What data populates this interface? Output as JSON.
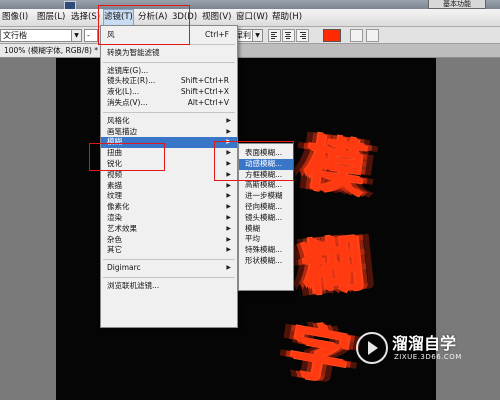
{
  "titlebar": {
    "zoom_fragment": "100%",
    "essentials_label": "基本功能"
  },
  "menubar": {
    "items": [
      "图像(I)",
      "图层(L)",
      "选择(S)",
      "滤镜(T)",
      "分析(A)",
      "3D(D)",
      "视图(V)",
      "窗口(W)",
      "帮助(H)"
    ],
    "active_index": 3
  },
  "options": {
    "font_family": "文行楷",
    "font_style": "-",
    "antialias": "犀利",
    "text_color": "#ff2a00"
  },
  "document": {
    "tab_label": "100% (模糊字体, RGB/8) *"
  },
  "canvas": {
    "chars": [
      "模",
      "糊",
      "字"
    ],
    "text_color": "#ff3a10"
  },
  "filter_menu": {
    "items": [
      {
        "label": "风",
        "shortcut": "Ctrl+F"
      },
      {
        "sep": true
      },
      {
        "label": "转换为智能滤镜"
      },
      {
        "sep": true
      },
      {
        "label": "滤镜库(G)..."
      },
      {
        "label": "镜头校正(R)...",
        "shortcut": "Shift+Ctrl+R"
      },
      {
        "label": "液化(L)...",
        "shortcut": "Shift+Ctrl+X"
      },
      {
        "label": "消失点(V)...",
        "shortcut": "Alt+Ctrl+V"
      },
      {
        "sep": true
      },
      {
        "label": "风格化",
        "submenu": true
      },
      {
        "label": "画笔描边",
        "submenu": true
      },
      {
        "label": "模糊",
        "submenu": true,
        "highlighted": true
      },
      {
        "label": "扭曲",
        "submenu": true
      },
      {
        "label": "锐化",
        "submenu": true
      },
      {
        "label": "视频",
        "submenu": true
      },
      {
        "label": "素描",
        "submenu": true
      },
      {
        "label": "纹理",
        "submenu": true
      },
      {
        "label": "像素化",
        "submenu": true
      },
      {
        "label": "渲染",
        "submenu": true
      },
      {
        "label": "艺术效果",
        "submenu": true
      },
      {
        "label": "杂色",
        "submenu": true
      },
      {
        "label": "其它",
        "submenu": true
      },
      {
        "sep": true
      },
      {
        "label": "Digimarc",
        "submenu": true
      },
      {
        "sep": true
      },
      {
        "label": "浏览联机滤镜..."
      }
    ]
  },
  "blur_submenu": {
    "items": [
      {
        "label": "表面模糊..."
      },
      {
        "label": "动感模糊...",
        "highlighted": true
      },
      {
        "label": "方框模糊..."
      },
      {
        "label": "高斯模糊..."
      },
      {
        "label": "进一步模糊"
      },
      {
        "label": "径向模糊..."
      },
      {
        "label": "镜头模糊..."
      },
      {
        "label": "模糊"
      },
      {
        "label": "平均"
      },
      {
        "label": "特殊模糊..."
      },
      {
        "label": "形状模糊..."
      }
    ]
  },
  "watermark": {
    "name": "溜溜自学",
    "url": "ZIXUE.3D66.COM"
  },
  "colors": {
    "highlight": "#3a76c8",
    "annotation_red": "#e01818"
  }
}
